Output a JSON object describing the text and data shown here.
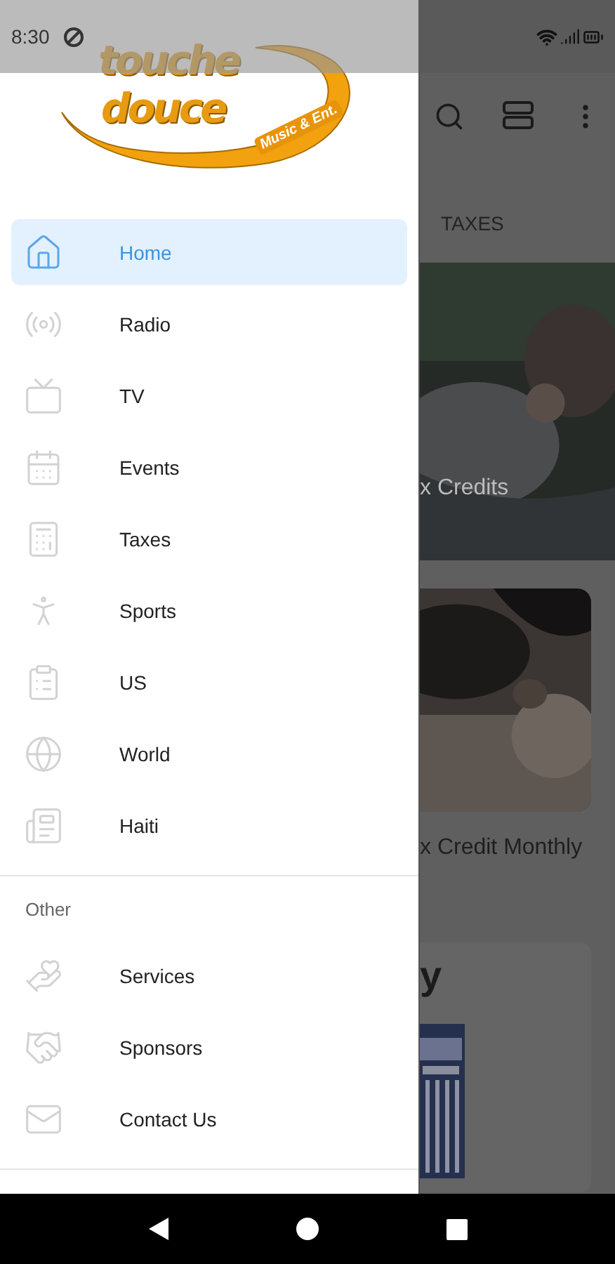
{
  "status_bar": {
    "time": "8:30"
  },
  "logo": {
    "line_1": "touche",
    "line_2": "douce",
    "tagline": "Music & Ent."
  },
  "drawer": {
    "items": [
      {
        "label": "Home",
        "selected": true
      },
      {
        "label": "Radio",
        "selected": false
      },
      {
        "label": "TV",
        "selected": false
      },
      {
        "label": "Events",
        "selected": false
      },
      {
        "label": "Taxes",
        "selected": false
      },
      {
        "label": "Sports",
        "selected": false
      },
      {
        "label": "US",
        "selected": false
      },
      {
        "label": "World",
        "selected": false
      },
      {
        "label": "Haiti",
        "selected": false
      }
    ],
    "other_section": {
      "title": "Other",
      "items": [
        {
          "label": "Services",
          "selected": false
        },
        {
          "label": "Sponsors",
          "selected": false
        },
        {
          "label": "Contact Us",
          "selected": false
        }
      ]
    }
  },
  "background_app": {
    "tabs": [
      {
        "label": "TAXES",
        "selected": false
      }
    ],
    "cards": [
      {
        "kind": "overlay",
        "caption": "x Credits"
      },
      {
        "kind": "below",
        "caption": "x Credit Monthly"
      },
      {
        "kind": "titled",
        "caption": "y"
      }
    ]
  }
}
